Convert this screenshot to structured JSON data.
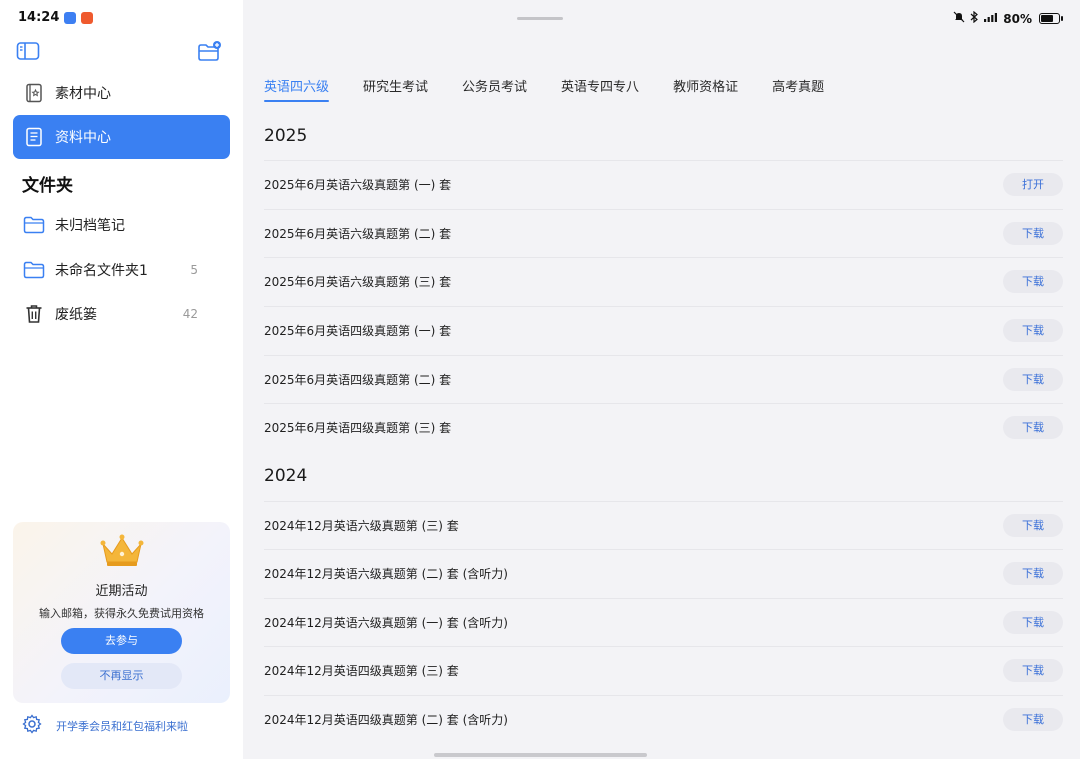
{
  "status_bar": {
    "time": "14:24",
    "battery": "80%",
    "battery_level": 0.8
  },
  "sidebar": {
    "nav": [
      {
        "label": "素材中心",
        "icon": "book-icon",
        "active": false
      },
      {
        "label": "资料中心",
        "icon": "document-icon",
        "active": true
      }
    ],
    "folders_heading": "文件夹",
    "folders": [
      {
        "label": "未归档笔记",
        "icon": "folder-icon",
        "count": ""
      },
      {
        "label": "未命名文件夹1",
        "icon": "folder-icon",
        "count": "5"
      },
      {
        "label": "废纸篓",
        "icon": "trash-icon",
        "count": "42"
      }
    ],
    "promo": {
      "title": "近期活动",
      "subtitle": "输入邮箱，获得永久免费试用资格",
      "primary_button": "去参与",
      "secondary_button": "不再显示"
    },
    "footer_link": "开学季会员和红包福利来啦"
  },
  "main": {
    "tabs": [
      {
        "label": "英语四六级",
        "active": true
      },
      {
        "label": "研究生考试",
        "active": false
      },
      {
        "label": "公务员考试",
        "active": false
      },
      {
        "label": "英语专四专八",
        "active": false
      },
      {
        "label": "教师资格证",
        "active": false
      },
      {
        "label": "高考真题",
        "active": false
      }
    ],
    "sections": [
      {
        "year": "2025",
        "items": [
          {
            "title": "2025年6月英语六级真题第 (一) 套",
            "action": "打开"
          },
          {
            "title": "2025年6月英语六级真题第 (二) 套",
            "action": "下载"
          },
          {
            "title": "2025年6月英语六级真题第 (三) 套",
            "action": "下载"
          },
          {
            "title": "2025年6月英语四级真题第 (一) 套",
            "action": "下载"
          },
          {
            "title": "2025年6月英语四级真题第 (二) 套",
            "action": "下载"
          },
          {
            "title": "2025年6月英语四级真题第 (三) 套",
            "action": "下载"
          }
        ]
      },
      {
        "year": "2024",
        "items": [
          {
            "title": "2024年12月英语六级真题第 (三) 套",
            "action": "下载"
          },
          {
            "title": "2024年12月英语六级真题第 (二) 套 (含听力)",
            "action": "下载"
          },
          {
            "title": "2024年12月英语六级真题第 (一) 套 (含听力)",
            "action": "下载"
          },
          {
            "title": "2024年12月英语四级真题第 (三) 套",
            "action": "下载"
          },
          {
            "title": "2024年12月英语四级真题第 (二) 套 (含听力)",
            "action": "下载"
          }
        ]
      }
    ]
  }
}
